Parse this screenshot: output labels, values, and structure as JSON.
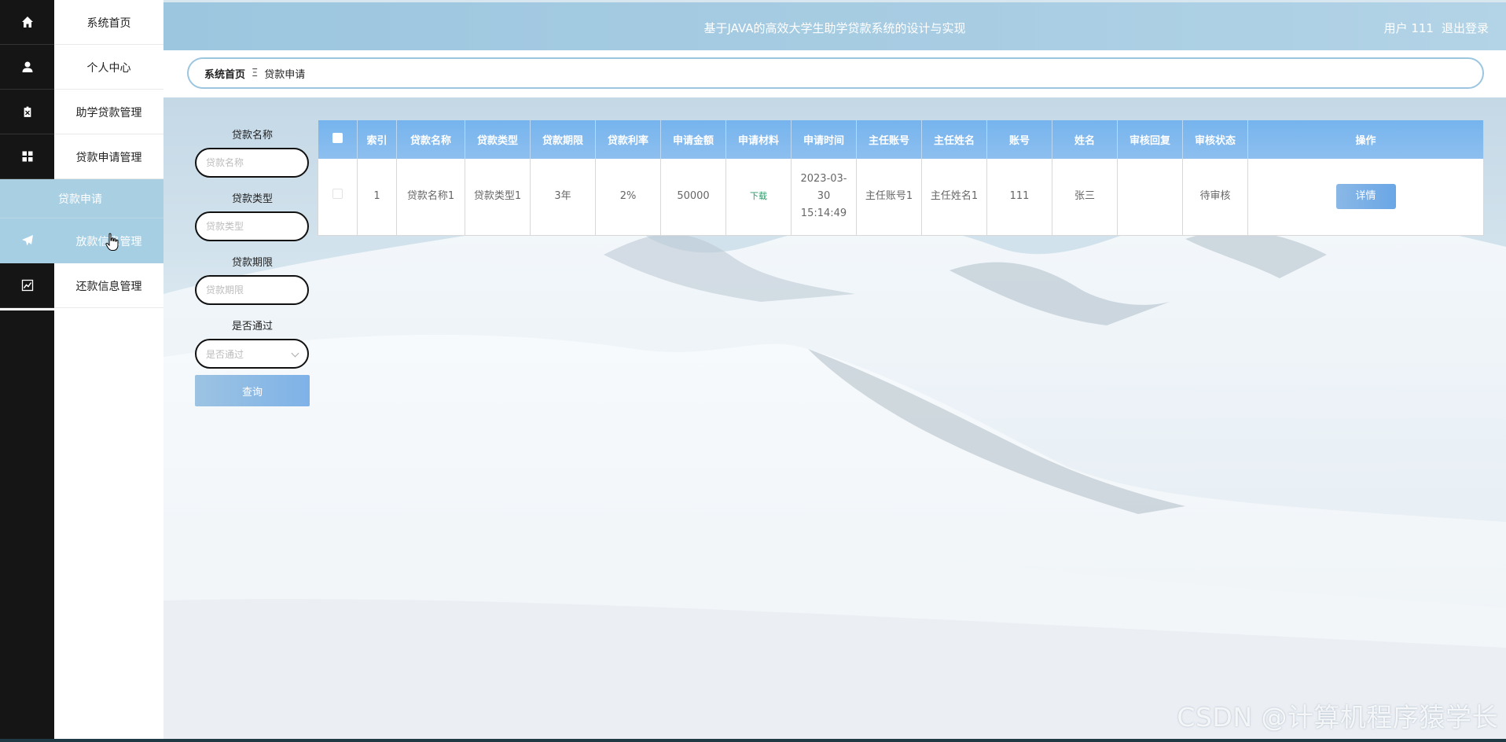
{
  "header": {
    "title": "基于JAVA的高效大学生助学贷款系统的设计与实现",
    "user_label": "用户 111",
    "logout": "退出登录"
  },
  "sidebar": {
    "items": [
      {
        "label": "系统首页",
        "icon": "home-icon"
      },
      {
        "label": "个人中心",
        "icon": "user-icon"
      },
      {
        "label": "助学贷款管理",
        "icon": "clipboard-icon"
      },
      {
        "label": "贷款申请管理",
        "icon": "grid-icon"
      },
      {
        "label": "放款信息管理",
        "icon": "paper-plane-icon"
      },
      {
        "label": "还款信息管理",
        "icon": "chart-icon"
      }
    ],
    "sub_item": "贷款申请"
  },
  "breadcrumb": {
    "home": "系统首页",
    "separator": "Ξ",
    "current": "贷款申请"
  },
  "search": {
    "fields": [
      {
        "label": "贷款名称",
        "placeholder": "贷款名称"
      },
      {
        "label": "贷款类型",
        "placeholder": "贷款类型"
      },
      {
        "label": "贷款期限",
        "placeholder": "贷款期限"
      },
      {
        "label": "是否通过",
        "placeholder": "是否通过"
      }
    ],
    "button": "查询"
  },
  "table": {
    "columns": [
      "索引",
      "贷款名称",
      "贷款类型",
      "贷款期限",
      "贷款利率",
      "申请金额",
      "申请材料",
      "申请时间",
      "主任账号",
      "主任姓名",
      "账号",
      "姓名",
      "审核回复",
      "审核状态",
      "操作"
    ],
    "rows": [
      {
        "index": "1",
        "loan_name": "贷款名称1",
        "loan_type": "贷款类型1",
        "term": "3年",
        "rate": "2%",
        "amount": "50000",
        "material": "下载",
        "apply_time": "2023-03-30 15:14:49",
        "director_account": "主任账号1",
        "director_name": "主任姓名1",
        "account": "111",
        "name": "张三",
        "reply": "",
        "status": "待审核",
        "action": "详情"
      }
    ]
  },
  "watermark": "CSDN @计算机程序猿学长",
  "colors": {
    "accent": "#9cc6df",
    "table_header": "#76b4ee",
    "sidebar_dark": "#151515",
    "active": "#a7cfe4"
  }
}
